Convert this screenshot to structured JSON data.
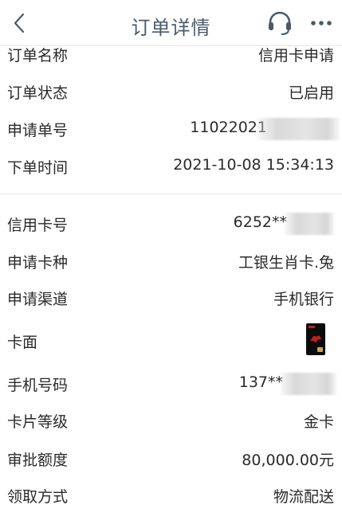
{
  "header": {
    "title": "订单详情",
    "back_icon": "chevron-left-icon",
    "service_icon": "headset-icon",
    "more_icon": "more-dots-icon"
  },
  "order": {
    "name_label": "订单名称",
    "name_value": "信用卡申请",
    "status_label": "订单状态",
    "status_value": "已启用",
    "number_label": "申请单号",
    "number_value": "11022021",
    "time_label": "下单时间",
    "time_value": "2021-10-08 15:34:13"
  },
  "card": {
    "number_label": "信用卡号",
    "number_value": "6252**",
    "type_label": "申请卡种",
    "type_value": "工银生肖卡.兔",
    "channel_label": "申请渠道",
    "channel_value": "手机银行",
    "face_label": "卡面",
    "phone_label": "手机号码",
    "phone_value": "137**",
    "level_label": "卡片等级",
    "level_value": "金卡",
    "limit_label": "审批额度",
    "limit_value": "80,000.00元",
    "pickup_label": "领取方式",
    "pickup_value": "物流配送"
  },
  "colors": {
    "title": "#4a5a6a",
    "text": "#2a2a2a",
    "divider": "#e6e6e6",
    "card_mark": "#c21e1e"
  }
}
